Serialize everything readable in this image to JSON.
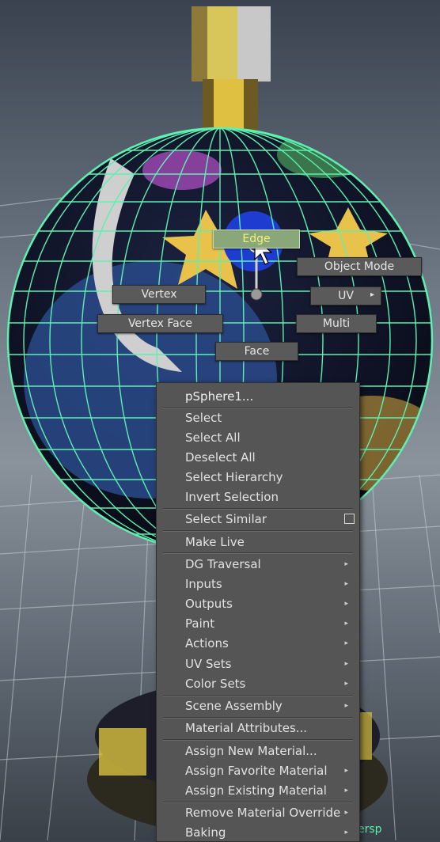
{
  "marking_menu": {
    "items": [
      {
        "label": "Edge",
        "active": true
      },
      {
        "label": "Object Mode"
      },
      {
        "label": "Vertex"
      },
      {
        "label": "UV",
        "submenu": true
      },
      {
        "label": "Vertex Face"
      },
      {
        "label": "Multi"
      },
      {
        "label": "Face"
      }
    ]
  },
  "context_menu": {
    "object_name": "pSphere1...",
    "items": [
      {
        "label": "Select"
      },
      {
        "label": "Select All"
      },
      {
        "label": "Deselect All"
      },
      {
        "label": "Select Hierarchy"
      },
      {
        "label": "Invert Selection"
      },
      {
        "label": "Select Similar",
        "option_box": true
      },
      {
        "label": "Make Live"
      },
      {
        "label": "DG Traversal",
        "submenu": true
      },
      {
        "label": "Inputs",
        "submenu": true
      },
      {
        "label": "Outputs",
        "submenu": true
      },
      {
        "label": "Paint",
        "submenu": true
      },
      {
        "label": "Actions",
        "submenu": true
      },
      {
        "label": "UV Sets",
        "submenu": true
      },
      {
        "label": "Color Sets",
        "submenu": true
      },
      {
        "label": "Scene Assembly",
        "submenu": true
      },
      {
        "label": "Material Attributes..."
      },
      {
        "label": "Assign New Material..."
      },
      {
        "label": "Assign Favorite Material",
        "submenu": true
      },
      {
        "label": "Assign Existing Material",
        "submenu": true
      },
      {
        "label": "Remove Material Override",
        "submenu": true
      },
      {
        "label": "Baking",
        "submenu": true
      }
    ]
  },
  "viewport": {
    "camera_label_fragment": "ersp",
    "wireframe_color": "#5ef0b0",
    "highlight_color": "#f3f07a"
  }
}
